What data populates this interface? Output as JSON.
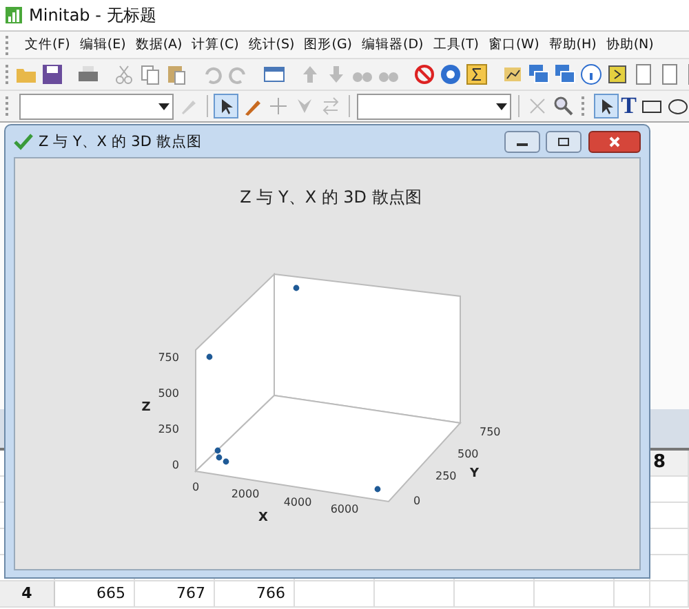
{
  "app": {
    "title": "Minitab - 无标题"
  },
  "menu": [
    "文件(F)",
    "编辑(E)",
    "数据(A)",
    "计算(C)",
    "统计(S)",
    "图形(G)",
    "编辑器(D)",
    "工具(T)",
    "窗口(W)",
    "帮助(H)",
    "协助(N)"
  ],
  "text_tool": "T",
  "graph_window": {
    "title": "Z 与 Y、X 的 3D 散点图",
    "plot": {
      "title": "Z 与 Y、X 的 3D 散点图",
      "z_label": "Z",
      "x_label": "X",
      "y_label": "Y",
      "z_ticks": [
        "750",
        "500",
        "250",
        "0"
      ],
      "x_ticks": [
        "0",
        "2000",
        "4000",
        "6000"
      ],
      "y_ticks": [
        "0",
        "250",
        "500",
        "750"
      ]
    }
  },
  "worksheet": {
    "column_header": "8",
    "rows": [
      {
        "row": "4",
        "cells": [
          "665",
          "767",
          "766"
        ]
      }
    ]
  }
}
